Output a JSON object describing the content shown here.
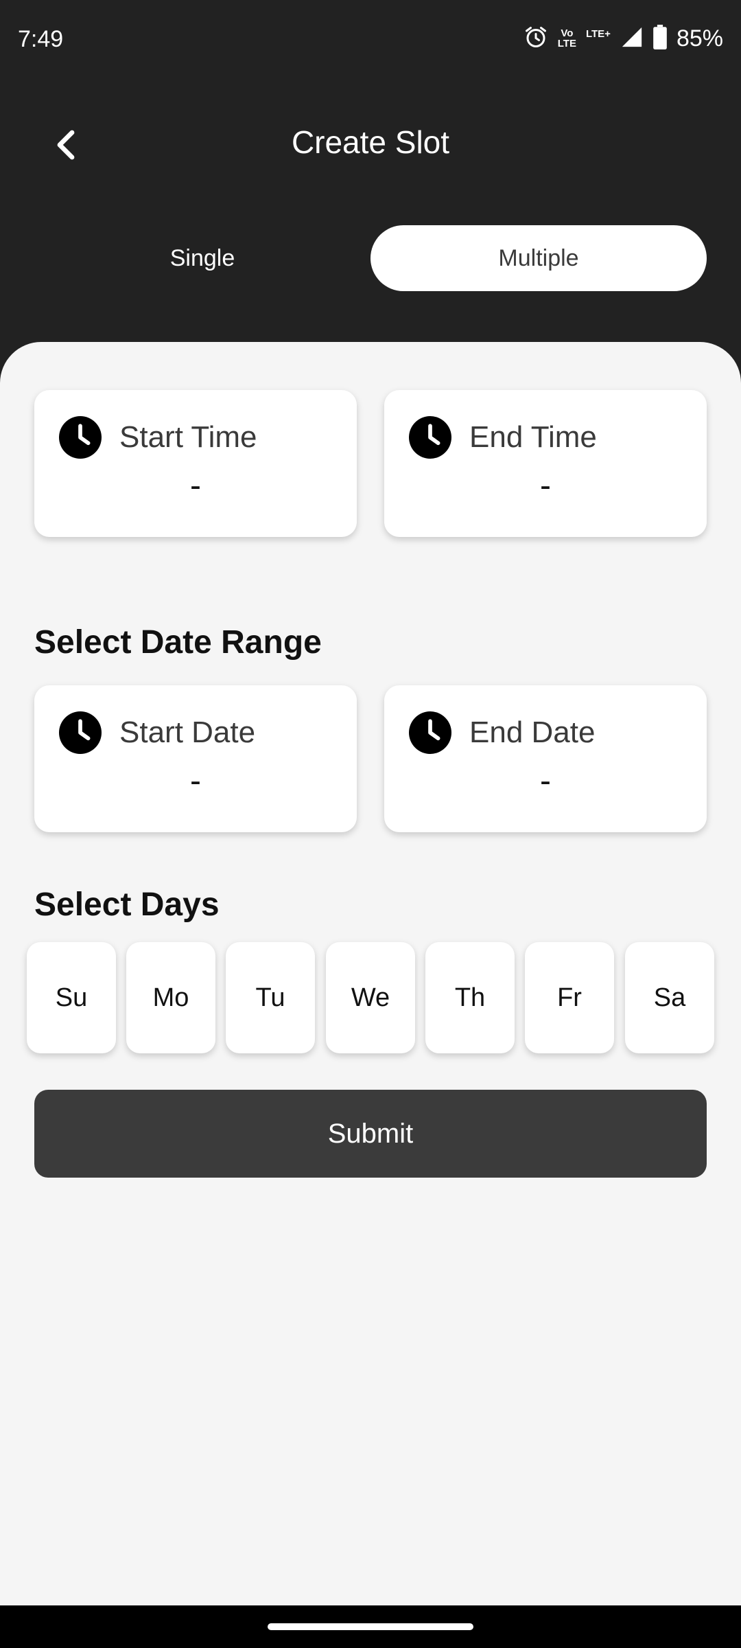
{
  "status_bar": {
    "time": "7:49",
    "vo_lte_top": "Vo",
    "vo_lte_bottom": "LTE",
    "lte_plus": "LTE+",
    "battery": "85%"
  },
  "header": {
    "title": "Create Slot"
  },
  "segments": {
    "single": "Single",
    "multiple": "Multiple",
    "selected": "Multiple"
  },
  "time_cards": {
    "start": {
      "label": "Start Time",
      "value": "-"
    },
    "end": {
      "label": "End Time",
      "value": "-"
    }
  },
  "date_range": {
    "title": "Select Date Range",
    "start": {
      "label": "Start Date",
      "value": "-"
    },
    "end": {
      "label": "End Date",
      "value": "-"
    }
  },
  "days": {
    "title": "Select Days",
    "items": [
      "Su",
      "Mo",
      "Tu",
      "We",
      "Th",
      "Fr",
      "Sa"
    ]
  },
  "submit_label": "Submit",
  "colors": {
    "header_bg": "#222222",
    "sheet_bg": "#f5f5f5",
    "button_bg": "#3b3b3b"
  }
}
